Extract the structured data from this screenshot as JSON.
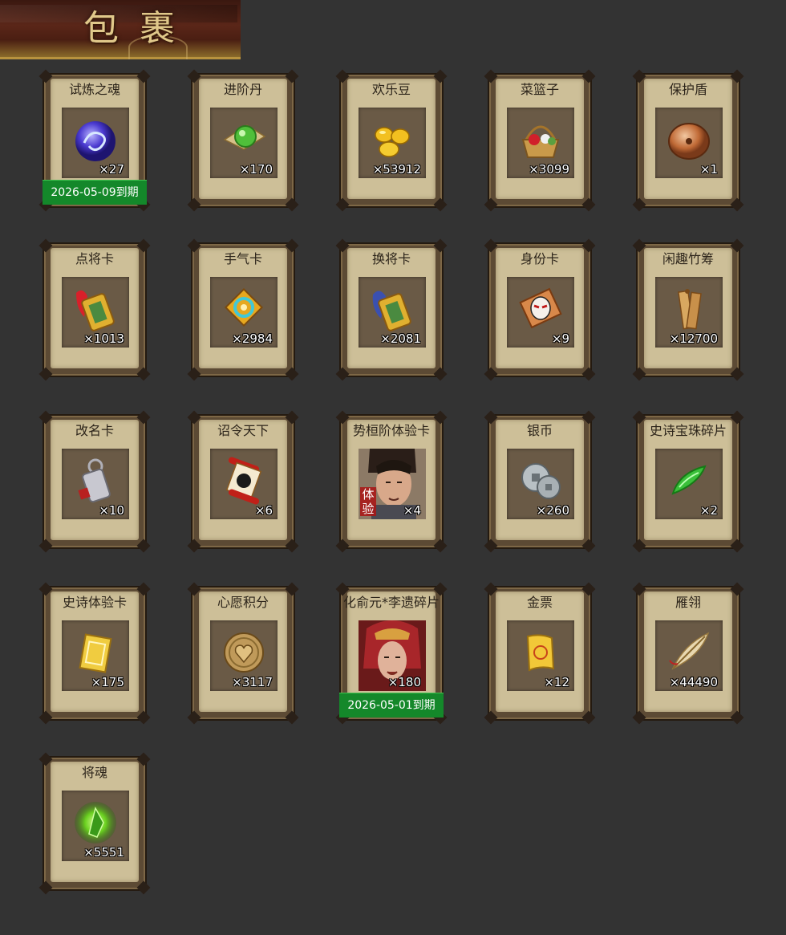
{
  "header": {
    "title": "包 裹"
  },
  "items": [
    {
      "name": "试炼之魂",
      "qty": "×27",
      "icon": "dragon-orb-icon",
      "expiry": "2026-05-09到期"
    },
    {
      "name": "进阶丹",
      "qty": "×170",
      "icon": "green-pill-icon"
    },
    {
      "name": "欢乐豆",
      "qty": "×53912",
      "icon": "gold-beans-icon"
    },
    {
      "name": "菜篮子",
      "qty": "×3099",
      "icon": "flower-basket-icon"
    },
    {
      "name": "保护盾",
      "qty": "×1",
      "icon": "round-shield-icon"
    },
    {
      "name": "点将卡",
      "qty": "×1013",
      "icon": "general-token-icon"
    },
    {
      "name": "手气卡",
      "qty": "×2984",
      "icon": "luck-card-icon"
    },
    {
      "name": "换将卡",
      "qty": "×2081",
      "icon": "swap-token-icon"
    },
    {
      "name": "身份卡",
      "qty": "×9",
      "icon": "opera-mask-card-icon"
    },
    {
      "name": "闲趣竹筹",
      "qty": "×12700",
      "icon": "bamboo-tally-icon"
    },
    {
      "name": "改名卡",
      "qty": "×10",
      "icon": "rename-token-icon"
    },
    {
      "name": "诏令天下",
      "qty": "×6",
      "icon": "edict-scroll-icon"
    },
    {
      "name": "势桓阶体验卡",
      "qty": "×4",
      "icon": "hero-portrait-icon",
      "badge": "体验"
    },
    {
      "name": "银币",
      "qty": "×260",
      "icon": "silver-coins-icon"
    },
    {
      "name": "史诗宝珠碎片",
      "qty": "×2",
      "icon": "jade-shard-icon"
    },
    {
      "name": "史诗体验卡",
      "qty": "×175",
      "icon": "gold-card-icon"
    },
    {
      "name": "心愿积分",
      "qty": "×3117",
      "icon": "heart-coin-icon"
    },
    {
      "name": "化俞元*李遗碎片",
      "qty": "×180",
      "icon": "warrior-portrait-icon",
      "expiry": "2026-05-01到期"
    },
    {
      "name": "金票",
      "qty": "×12",
      "icon": "gold-ticket-icon"
    },
    {
      "name": "雁翎",
      "qty": "×44490",
      "icon": "feather-icon"
    },
    {
      "name": "将魂",
      "qty": "×5551",
      "icon": "green-crystal-icon"
    }
  ]
}
